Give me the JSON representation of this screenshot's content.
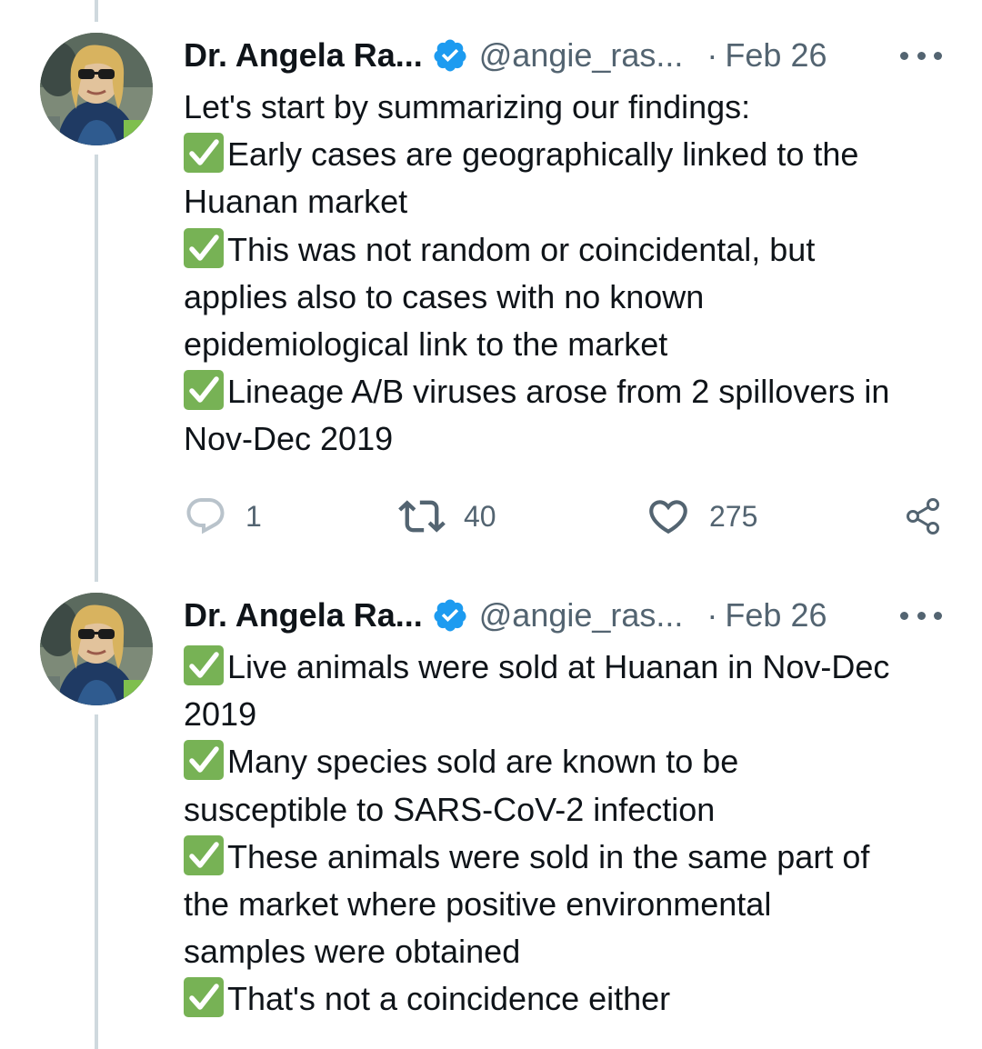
{
  "tweets": [
    {
      "author": {
        "name": "Dr. Angela Ra...",
        "handle": "@angie_ras...",
        "verified": true
      },
      "separator": "·",
      "date": "Feb 26",
      "lines": [
        "Let's start by summarizing our findings:",
        "Early cases are geographically linked to the",
        "Huanan market",
        "This was not random or coincidental, but",
        "applies also to cases with no known",
        "epidemiological link to the market",
        "Lineage A/B viruses arose from 2 spillovers in",
        "Nov-Dec 2019"
      ],
      "actions": {
        "replies": "1",
        "retweets": "40",
        "likes": "275"
      }
    },
    {
      "author": {
        "name": "Dr. Angela Ra...",
        "handle": "@angie_ras...",
        "verified": true
      },
      "separator": "·",
      "date": "Feb 26",
      "lines": [
        "Live animals were sold at Huanan in Nov-Dec",
        "2019",
        "Many species sold are known to be",
        "susceptible to SARS-CoV-2 infection",
        "These animals were sold in the same part of",
        "the market where positive environmental",
        "samples were obtained",
        "That's not a coincidence either"
      ]
    }
  ],
  "colors": {
    "verified_badge": "#1d9bf0",
    "check_emoji": "#77b255",
    "secondary_text": "#536471",
    "thread_line": "#cfd9de"
  },
  "icons": {
    "check": "white-heavy-check-mark-icon",
    "verified": "verified-badge-icon",
    "reply": "reply-icon",
    "retweet": "retweet-icon",
    "like": "heart-icon",
    "share": "share-icon",
    "more": "more-icon"
  }
}
